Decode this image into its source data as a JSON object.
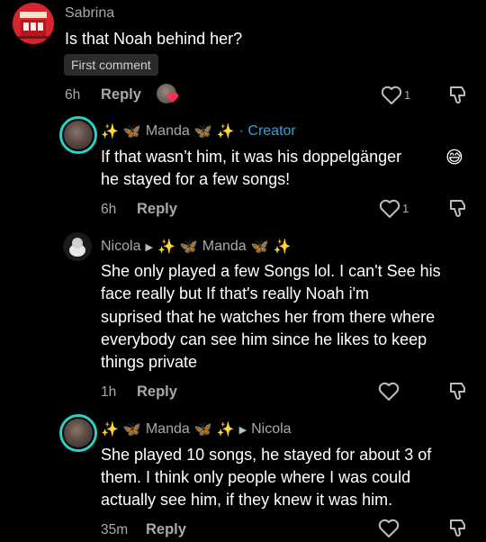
{
  "comments": [
    {
      "username": "Sabrina",
      "text": "Is that Noah behind her?",
      "badge": "First comment",
      "time": "6h",
      "reply_label": "Reply",
      "likes": "1"
    },
    {
      "username": "Manda",
      "creator_label": "· Creator",
      "text_line1": "If that wasn’t him, it was his doppelgänger",
      "text_line2": "he stayed for a few songs!",
      "time": "6h",
      "reply_label": "Reply",
      "likes": "1"
    },
    {
      "username": "Nicola",
      "reply_to": "Manda",
      "text_lines": [
        "She only played a few Songs lol. I can't See his",
        "face really but If that's really Noah i'm",
        "suprised that he watches her from there where",
        "everybody can see him since he likes to keep",
        "things private"
      ],
      "time": "1h",
      "reply_label": "Reply"
    },
    {
      "username": "Manda",
      "reply_to": "Nicola",
      "text_lines": [
        "She played 10 songs, he stayed for about 3 of",
        "them. I think only people where I was could",
        "actually see him, if they knew it was him."
      ],
      "time": "35m",
      "reply_label": "Reply"
    }
  ],
  "colors": {
    "background": "#000000",
    "muted": "#a9a9a9",
    "creator": "#2fa3e0",
    "avatar_ring": "#2bd0c5",
    "like_badge": "#ff2d55"
  }
}
